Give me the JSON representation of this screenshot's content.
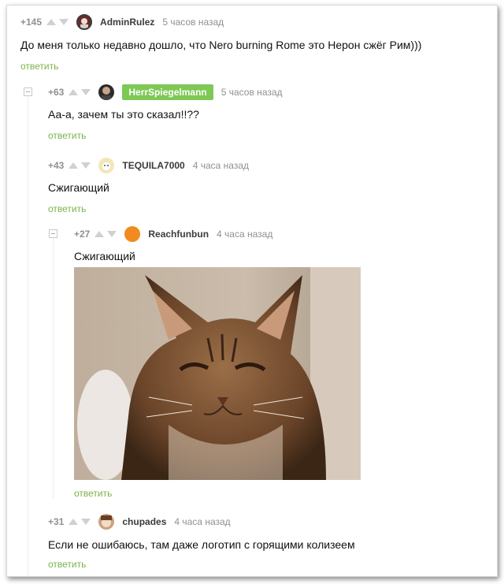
{
  "comments": [
    {
      "score": "+145",
      "author": "AdminRulez",
      "time": "5 часов назад",
      "text": "До меня только недавно дошло, что Nero burning Rome это Нерон сжёг Рим)))",
      "reply_label": "ответить"
    },
    {
      "score": "+63",
      "author": "HerrSpiegelmann",
      "time": "5 часов назад",
      "text": "Аа-а, зачем ты это сказал!!??",
      "reply_label": "ответить"
    },
    {
      "score": "+43",
      "author": "TEQUILA7000",
      "time": "4 часа назад",
      "text": "Сжигающий",
      "reply_label": "ответить"
    },
    {
      "score": "+27",
      "author": "Reachfunbun",
      "time": "4 часа назад",
      "text": "Сжигающий",
      "reply_label": "ответить"
    },
    {
      "score": "+31",
      "author": "chupades",
      "time": "4 часа назад",
      "text": "Если не ошибаюсь, там даже логотип с горящими колизеем",
      "reply_label": "ответить"
    }
  ],
  "colors": {
    "reply": "#7ab34a",
    "badge": "#7ec855",
    "meta": "#8f9092",
    "nick": "#3a3b3d",
    "reachfunbun_avatar": "#f28a1f"
  },
  "icons": [
    "upvote-arrow-icon",
    "downvote-arrow-icon",
    "collapse-icon"
  ]
}
